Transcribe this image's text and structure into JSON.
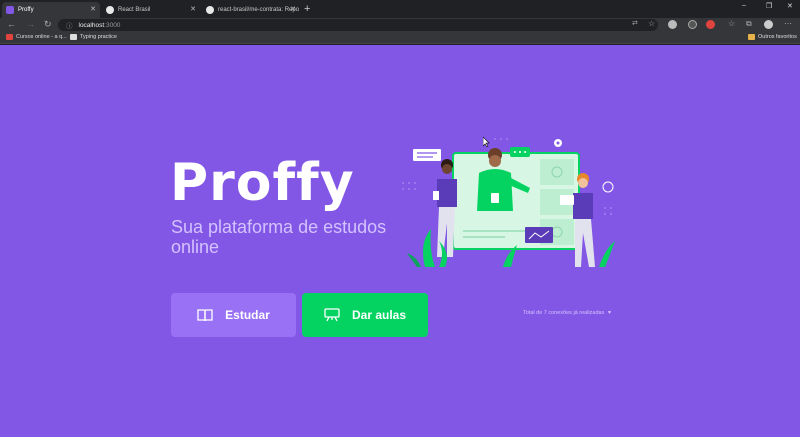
{
  "browser": {
    "tabs": [
      {
        "title": "Proffy",
        "active": true
      },
      {
        "title": "React Brasil",
        "active": false
      },
      {
        "title": "react-brasil/me-contrata: Repo",
        "active": false
      }
    ],
    "new_tab_symbol": "+",
    "url_host": "localhost",
    "url_port": ":3000",
    "bookmarks": [
      {
        "label": "Cursos online - a q..."
      },
      {
        "label": "Typing practice"
      }
    ],
    "other_favorites": "Outros favoritos",
    "window_controls": [
      "–",
      "❐",
      "✕"
    ]
  },
  "page": {
    "logo": "Proffy",
    "tagline": "Sua plataforma de estudos online",
    "buttons": {
      "study_label": "Estudar",
      "teach_label": "Dar aulas"
    },
    "total_connections": "Total de 7 conexões já realizadas",
    "heart_symbol": "♥",
    "colors": {
      "primary": "#8257e5",
      "primary_lighter": "#9871f5",
      "secondary": "#04d361",
      "text_in_primary": "#d4c2ff"
    }
  }
}
